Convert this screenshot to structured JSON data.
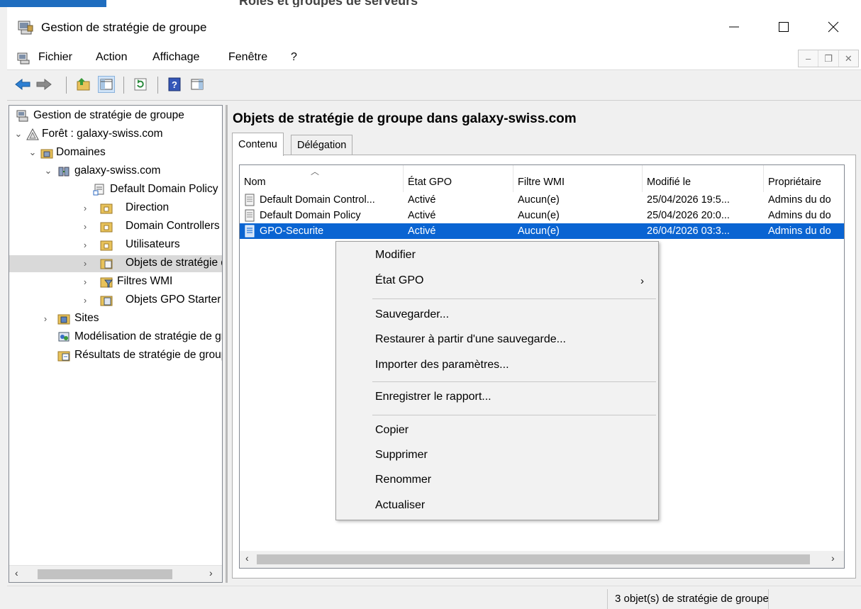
{
  "background_window": {
    "title": "Rôles et groupes de serveurs"
  },
  "window": {
    "title": "Gestion de stratégie de groupe"
  },
  "menu": {
    "items": [
      "Fichier",
      "Action",
      "Affichage",
      "Fenêtre",
      "?"
    ]
  },
  "tree": {
    "items": [
      {
        "label": "Gestion de stratégie de groupe",
        "icon": "gpmc-console-icon"
      },
      {
        "label": "Forêt : galaxy-swiss.com",
        "icon": "forest-icon"
      },
      {
        "label": "Domaines",
        "icon": "domains-folder-icon"
      },
      {
        "label": "galaxy-swiss.com",
        "icon": "domain-icon"
      },
      {
        "label": "Default Domain Policy",
        "icon": "gpo-link-icon"
      },
      {
        "label": "Direction",
        "icon": "ou-folder-icon"
      },
      {
        "label": "Domain Controllers",
        "icon": "ou-folder-icon"
      },
      {
        "label": "Utilisateurs",
        "icon": "ou-folder-icon"
      },
      {
        "label": "Objets de stratégie de groupe",
        "icon": "gpo-folder-icon"
      },
      {
        "label": "Filtres WMI",
        "icon": "wmi-folder-icon"
      },
      {
        "label": "Objets GPO Starter",
        "icon": "starter-gpo-folder-icon"
      },
      {
        "label": "Sites",
        "icon": "sites-icon"
      },
      {
        "label": "Modélisation de stratégie de groupe",
        "icon": "modeling-icon"
      },
      {
        "label": "Résultats de stratégie de groupe",
        "icon": "results-icon"
      }
    ]
  },
  "main": {
    "title": "Objets de stratégie de groupe dans galaxy-swiss.com",
    "tabs": [
      "Contenu",
      "Délégation"
    ],
    "columns": [
      "Nom",
      "État GPO",
      "Filtre WMI",
      "Modifié le",
      "Propriétaire"
    ],
    "rows": [
      {
        "name": "Default Domain Control...",
        "state": "Activé",
        "wmi": "Aucun(e)",
        "modified": "25/04/2026 19:5...",
        "owner": "Admins du do"
      },
      {
        "name": "Default Domain Policy",
        "state": "Activé",
        "wmi": "Aucun(e)",
        "modified": "25/04/2026 20:0...",
        "owner": "Admins du do"
      },
      {
        "name": "GPO-Securite",
        "state": "Activé",
        "wmi": "Aucun(e)",
        "modified": "26/04/2026 03:3...",
        "owner": "Admins du do"
      }
    ]
  },
  "context_menu": {
    "items": [
      "Modifier",
      "État GPO",
      "Sauvegarder...",
      "Restaurer à partir d'une sauvegarde...",
      "Importer des paramètres...",
      "Enregistrer le rapport...",
      "Copier",
      "Supprimer",
      "Renommer",
      "Actualiser"
    ]
  },
  "status": {
    "text": "3 objet(s) de stratégie de groupe"
  },
  "colors": {
    "selection": "#0a64d2",
    "tree_selection": "#d9d9d9",
    "folder": "#e8c25a"
  }
}
